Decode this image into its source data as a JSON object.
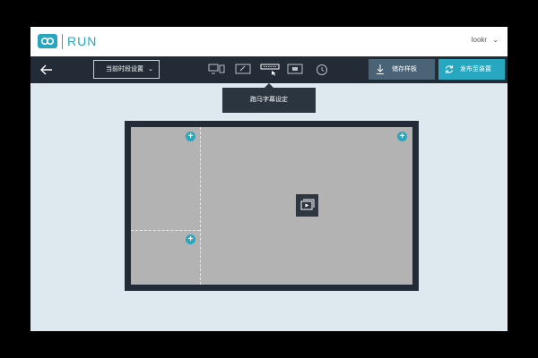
{
  "header": {
    "brand": "RUN",
    "user": "lookr",
    "user_chevron": "⌄"
  },
  "toolbar": {
    "period_select": "当前时段设置",
    "period_arrow": "⌄",
    "save_label": "储存样板",
    "publish_label": "发布至装置",
    "tools": [
      "screens-icon",
      "edit-icon",
      "marquee-icon",
      "display-icon",
      "clock-icon"
    ]
  },
  "tooltip": {
    "text": "跑马字幕设定"
  },
  "canvas": {
    "add_label": "+"
  },
  "colors": {
    "accent": "#27a8c0",
    "toolbar_bg": "#222b36",
    "workspace_bg": "#dde8ef",
    "screen_bg": "#b3b3b3",
    "save_btn": "#4a6377"
  }
}
